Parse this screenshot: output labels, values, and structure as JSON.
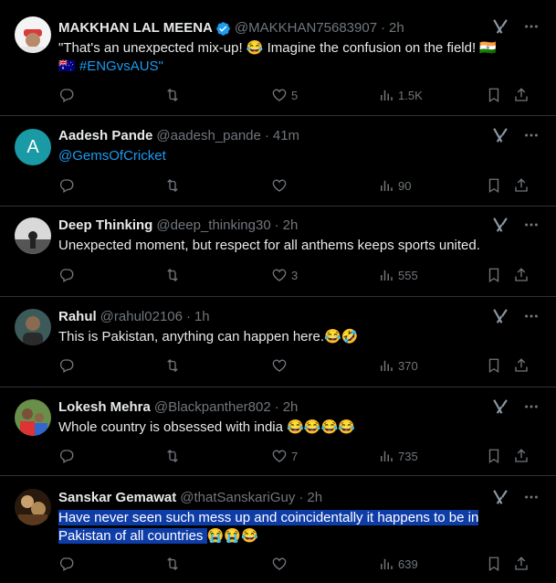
{
  "tweets": [
    {
      "name": "MAKKHAN LAL MEENA",
      "verified": true,
      "handle": "@MAKKHAN75683907",
      "time": "2h",
      "text_line1": "\"That's an unexpected mix-up! 😂 Imagine the confusion on the field! 🇮🇳",
      "text_line2_flag": "🇦🇺",
      "hashtag": "#ENGvsAUS\"",
      "replies": "",
      "retweets": "",
      "likes": "5",
      "views": "1.5K"
    },
    {
      "name": "Aadesh Pande",
      "handle": "@aadesh_pande",
      "time": "41m",
      "avatar_letter": "A",
      "mention": "@GemsOfCricket",
      "likes": "",
      "views": "90"
    },
    {
      "name": "Deep Thinking",
      "handle": "@deep_thinking30",
      "time": "2h",
      "text": "Unexpected moment, but respect for all anthems keeps sports united.",
      "likes": "3",
      "views": "555"
    },
    {
      "name": "Rahul",
      "handle": "@rahul02106",
      "time": "1h",
      "text": "This is Pakistan, anything can happen here.😂🤣",
      "likes": "",
      "views": "370"
    },
    {
      "name": "Lokesh Mehra",
      "handle": "@Blackpanther802",
      "time": "2h",
      "text": "Whole country is obsessed with india 😂😂😂😂",
      "likes": "7",
      "views": "735"
    },
    {
      "name": "Sanskar Gemawat",
      "handle": "@thatSanskariGuy",
      "time": "2h",
      "text_line1": "Have never seen such mess up and coincidentally it happens to be in",
      "text_line2": "Pakistan of all countries",
      "text_line2_emoji": "😭😭😂",
      "likes": "",
      "views": "639"
    }
  ],
  "dot": "·",
  "colors": {
    "background": "#000000",
    "text": "#e7e9ea",
    "muted": "#71767b",
    "link": "#1d9bf0",
    "verified": "#1d9bf0",
    "selection": "#0f3da8",
    "avatar_A": "#1a9aa5"
  },
  "icons": [
    "reply-icon",
    "retweet-icon",
    "like-icon",
    "views-icon",
    "bookmark-icon",
    "share-icon",
    "grok-icon",
    "more-icon",
    "verified-icon"
  ]
}
